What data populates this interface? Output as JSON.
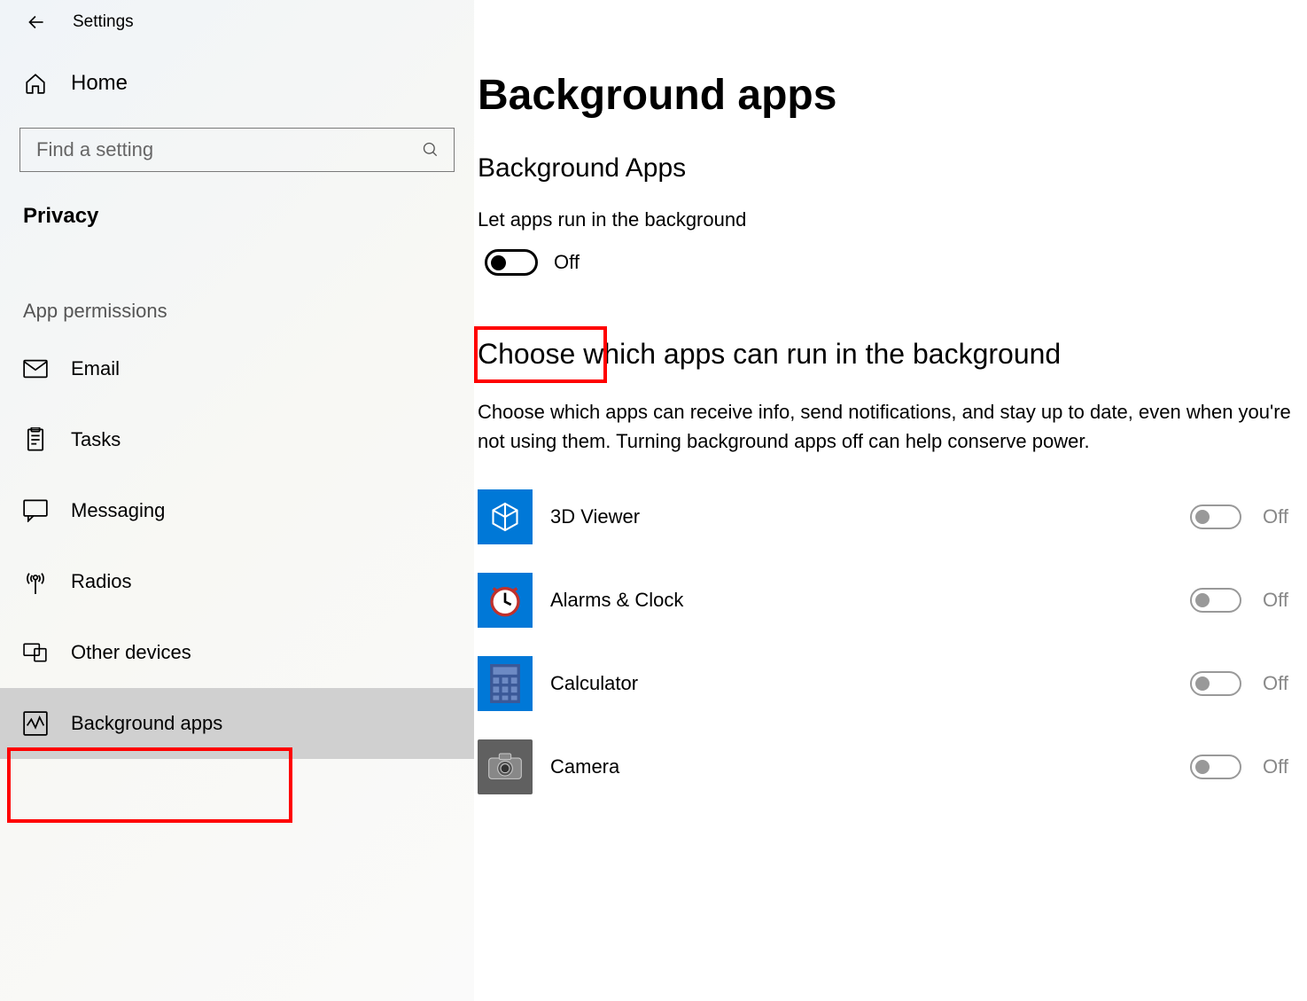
{
  "window": {
    "title": "Settings"
  },
  "sidebar": {
    "home_label": "Home",
    "search_placeholder": "Find a setting",
    "category_label": "Privacy",
    "section_label": "App permissions",
    "items": [
      {
        "label": "Email",
        "icon": "mail-icon"
      },
      {
        "label": "Tasks",
        "icon": "clipboard-icon"
      },
      {
        "label": "Messaging",
        "icon": "chat-icon"
      },
      {
        "label": "Radios",
        "icon": "antenna-icon"
      },
      {
        "label": "Other devices",
        "icon": "devices-icon"
      },
      {
        "label": "Background apps",
        "icon": "activity-icon",
        "selected": true
      }
    ]
  },
  "main": {
    "title": "Background apps",
    "section1_title": "Background Apps",
    "toggle_label": "Let apps run in the background",
    "toggle_state": "Off",
    "section2_title": "Choose which apps can run in the background",
    "description": "Choose which apps can receive info, send notifications, and stay up to date, even when you're not using them. Turning background apps off can help conserve power.",
    "apps": [
      {
        "name": "3D Viewer",
        "state": "Off",
        "icon_bg": "#0078d7"
      },
      {
        "name": "Alarms & Clock",
        "state": "Off",
        "icon_bg": "#0078d7"
      },
      {
        "name": "Calculator",
        "state": "Off",
        "icon_bg": "#0078d7"
      },
      {
        "name": "Camera",
        "state": "Off",
        "icon_bg": "#606060"
      }
    ]
  }
}
